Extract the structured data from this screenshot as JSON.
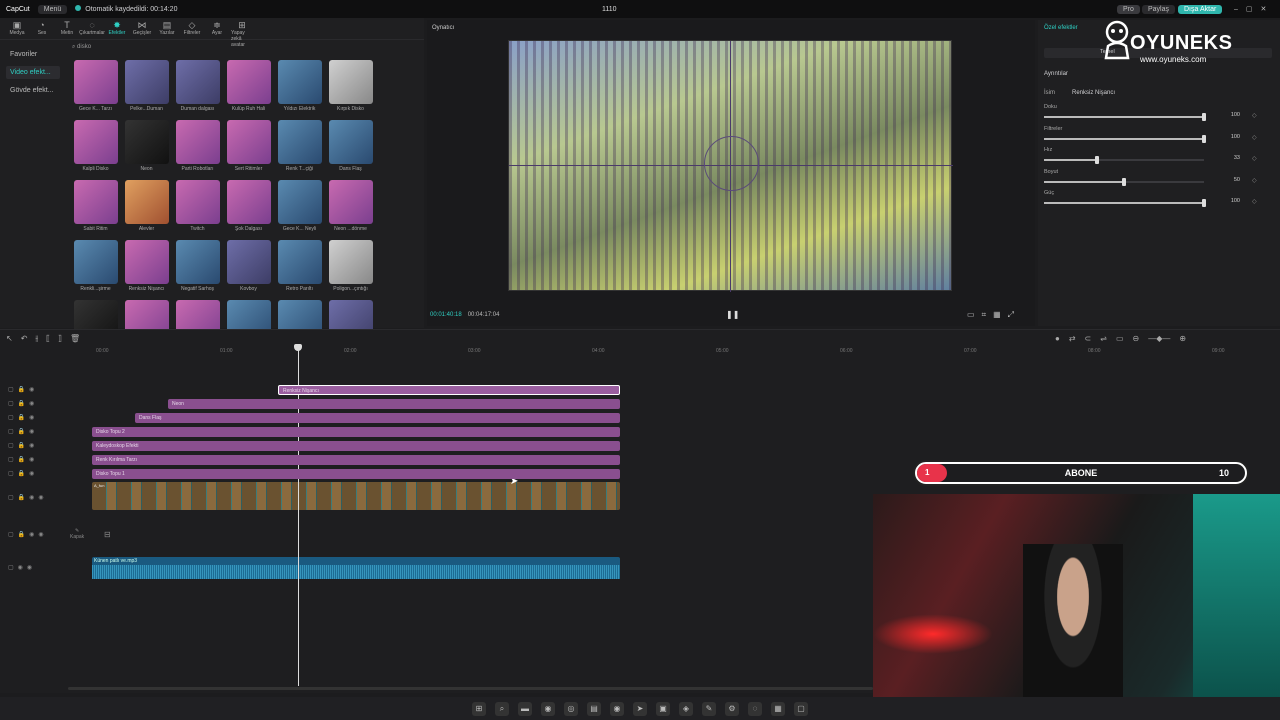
{
  "titlebar": {
    "app": "CapCut",
    "menu": "Menü",
    "autosave": "Otomatik kaydedildi: 00:14:20",
    "project": "1110",
    "pro": "Pro",
    "share": "Paylaş",
    "export": "Dışa Aktar"
  },
  "toolbar": [
    {
      "icon": "media-icon",
      "glyph": "▣",
      "label": "Medya"
    },
    {
      "icon": "audio-icon",
      "glyph": "◔",
      "label": "Ses"
    },
    {
      "icon": "text-icon",
      "glyph": "T",
      "label": "Metin"
    },
    {
      "icon": "sticker-icon",
      "glyph": "◌",
      "label": "Çıkartmalar"
    },
    {
      "icon": "effects-icon",
      "glyph": "✸",
      "label": "Efektler",
      "active": true
    },
    {
      "icon": "transitions-icon",
      "glyph": "⋈",
      "label": "Geçişler"
    },
    {
      "icon": "captions-icon",
      "glyph": "▤",
      "label": "Yazılar"
    },
    {
      "icon": "filters-icon",
      "glyph": "◇",
      "label": "Filtreler"
    },
    {
      "icon": "adjust-icon",
      "glyph": "≑",
      "label": "Ayar"
    },
    {
      "icon": "ai-avatar-icon",
      "glyph": "⊞",
      "label": "Yapay zekâ avatar"
    }
  ],
  "sidebar": [
    {
      "label": "Favoriler",
      "sel": false
    },
    {
      "label": "Video efekt...",
      "sel": true
    },
    {
      "label": "Gövde efekt...",
      "sel": false
    }
  ],
  "search": {
    "placeholder": "disko"
  },
  "effects": [
    {
      "label": "Gece K... Tarzı",
      "t": ""
    },
    {
      "label": "Pelke...Duman",
      "t": "b"
    },
    {
      "label": "Duman dalgası",
      "t": "b"
    },
    {
      "label": "Kulüp Ruh Hali",
      "t": ""
    },
    {
      "label": "Yıldızı Elektrik",
      "t": "d"
    },
    {
      "label": "Kırpık Disko",
      "t": "e"
    },
    {
      "label": "Kalpli Disko",
      "t": ""
    },
    {
      "label": "Neon",
      "t": "f"
    },
    {
      "label": "Parti Robotları",
      "t": ""
    },
    {
      "label": "Sert Ritimler",
      "t": ""
    },
    {
      "label": "Renk T...çiği",
      "t": "d"
    },
    {
      "label": "Dans Flaş",
      "t": "d"
    },
    {
      "label": "Sabit Ritim",
      "t": ""
    },
    {
      "label": "Alevler",
      "t": "c"
    },
    {
      "label": "Twitch",
      "t": ""
    },
    {
      "label": "Şok Dalgası",
      "t": ""
    },
    {
      "label": "Gece K... Neyli",
      "t": "d"
    },
    {
      "label": "Neon ...dönme",
      "t": ""
    },
    {
      "label": "Renkli...şirme",
      "t": "d"
    },
    {
      "label": "Renksiz Nişancı",
      "t": ""
    },
    {
      "label": "Negatif Sarhoş",
      "t": "d"
    },
    {
      "label": "Kovboy",
      "t": "b"
    },
    {
      "label": "Retro Parıltı",
      "t": "d"
    },
    {
      "label": "Poligon...çıntığı",
      "t": "e"
    },
    {
      "label": "",
      "t": "f"
    },
    {
      "label": "",
      "t": ""
    },
    {
      "label": "",
      "t": ""
    },
    {
      "label": "",
      "t": "d"
    },
    {
      "label": "",
      "t": "d"
    },
    {
      "label": "",
      "t": "b"
    }
  ],
  "player": {
    "title": "Oynatıcı",
    "current": "00:01:40:18",
    "total": "00:04:17:04"
  },
  "props": {
    "title": "Özel efektler",
    "tab": "Temel",
    "details": "Ayrıntılar",
    "name_label": "İsim",
    "name_value": "Renksiz Nişancı",
    "sliders": [
      {
        "label": "Doku",
        "value": 100
      },
      {
        "label": "Filtreler",
        "value": 100
      },
      {
        "label": "Hız",
        "value": 33
      },
      {
        "label": "Boyut",
        "value": 50
      },
      {
        "label": "Güç",
        "value": 100
      }
    ]
  },
  "logo": {
    "name": "OYUNEKS",
    "url": "www.oyuneks.com"
  },
  "timeline": {
    "ruler": [
      "00:00",
      "01:00",
      "02:00",
      "03:00",
      "04:00",
      "05:00",
      "06:00",
      "07:00",
      "08:00",
      "09:00"
    ],
    "effect_tracks": [
      {
        "label": "Renksiz Nişancı",
        "start": 0.0,
        "sel": true
      },
      {
        "label": "Neon",
        "start": 0.0
      },
      {
        "label": "Dans Flaş",
        "start": 0.0
      },
      {
        "label": "Disko Topu 2",
        "start": 0.0
      },
      {
        "label": "Kaleydoskop Efekti",
        "start": 0.0
      },
      {
        "label": "Renk Kırılma Tarzı",
        "start": 0.0
      },
      {
        "label": "Disko Topu 1",
        "start": 0.0
      }
    ],
    "video_label": "A_fun",
    "cover": "Kapak",
    "audio_label": "Künen patlı ve.mp3"
  },
  "abone": {
    "bubble": "1",
    "text": "ABONE",
    "count": "10"
  }
}
